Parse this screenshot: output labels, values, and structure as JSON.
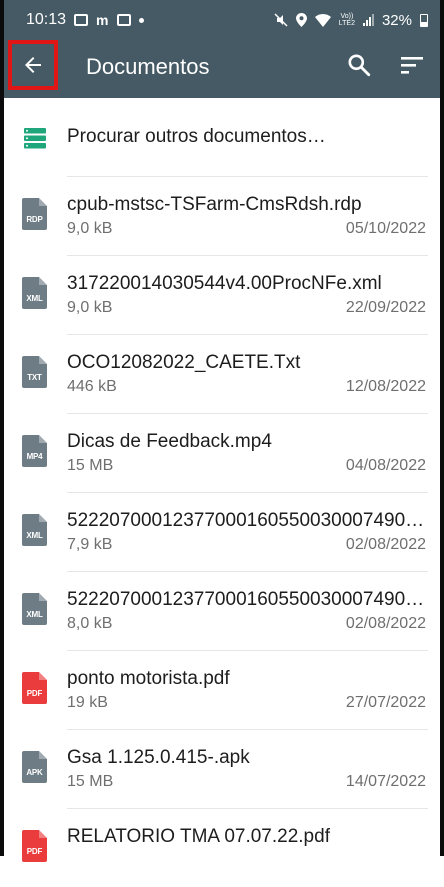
{
  "status_bar": {
    "time": "10:13",
    "m_label": "m",
    "volte_top": "Vo))",
    "volte_bottom": "LTE2",
    "battery": "32%"
  },
  "app_bar": {
    "title": "Documentos",
    "highlight_color": "#e01616",
    "background_color": "#455a64"
  },
  "browse": {
    "label": "Procurar outros documentos…"
  },
  "documents": [
    {
      "ext": "RDP",
      "name": "cpub-mstsc-TSFarm-CmsRdsh.rdp",
      "size": "9,0 kB",
      "date": "05/10/2022",
      "color": "#6d7c85"
    },
    {
      "ext": "XML",
      "name": "31722001403054­4v4.00ProcNFe.xml",
      "size": "9,0 kB",
      "date": "22/09/2022",
      "color": "#6d7c85"
    },
    {
      "ext": "TXT",
      "name": "OCO12082022_CAETE.Txt",
      "size": "446 kB",
      "date": "12/08/2022",
      "color": "#6d7c85"
    },
    {
      "ext": "MP4",
      "name": "Dicas de Feedback.mp4",
      "size": "15 MB",
      "date": "04/08/2022",
      "color": "#6d7c85"
    },
    {
      "ext": "XML",
      "name": "52220700012377000160550030007490…",
      "size": "7,9 kB",
      "date": "02/08/2022",
      "color": "#6d7c85"
    },
    {
      "ext": "XML",
      "name": "52220700012377000160550030007490…",
      "size": "8,0 kB",
      "date": "02/08/2022",
      "color": "#6d7c85"
    },
    {
      "ext": "PDF",
      "name": "ponto motorista.pdf",
      "size": "19 kB",
      "date": "27/07/2022",
      "color": "#ea3c3c"
    },
    {
      "ext": "APK",
      "name": "Gsa 1.125.0.415-.apk",
      "size": "15 MB",
      "date": "14/07/2022",
      "color": "#6d7c85"
    },
    {
      "ext": "PDF",
      "name": "RELATORIO TMA 07.07.22.pdf",
      "size": "",
      "date": "",
      "color": "#ea3c3c"
    }
  ]
}
